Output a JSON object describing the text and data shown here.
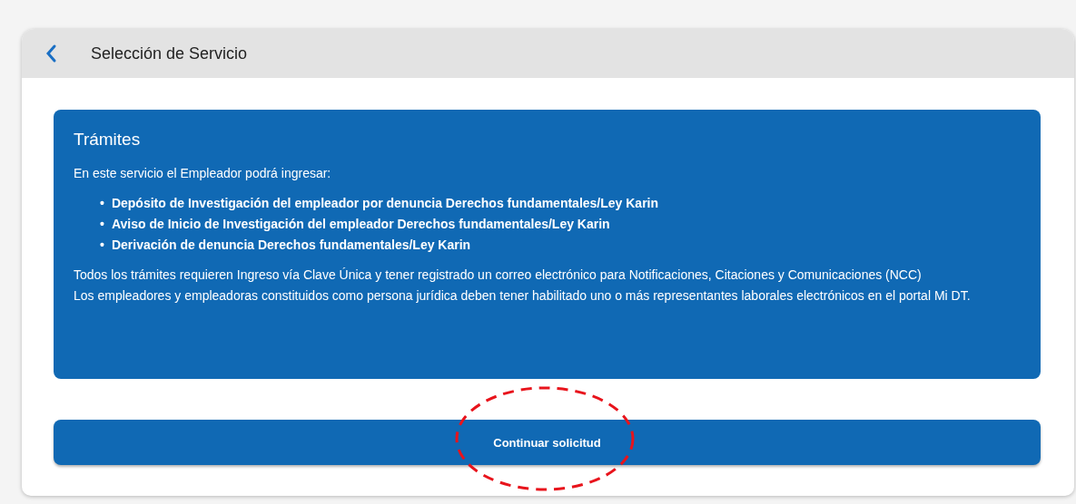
{
  "header": {
    "title": "Selección de Servicio"
  },
  "info_panel": {
    "title": "Trámites",
    "intro": "En este servicio el Empleador podrá ingresar:",
    "items": [
      {
        "bullet": "•",
        "text": "Depósito de Investigación del empleador por denuncia Derechos fundamentales/Ley Karin"
      },
      {
        "bullet": "•",
        "text": "Aviso de Inicio de Investigación del empleador Derechos fundamentales/Ley Karin"
      },
      {
        "bullet": "•",
        "text": "Derivación de denuncia Derechos fundamentales/Ley Karin"
      }
    ],
    "notes": [
      "Todos los trámites requieren Ingreso vía Clave Única y tener registrado un correo electrónico para Notificaciones, Citaciones y Comunicaciones (NCC)",
      "Los empleadores y empleadoras constituidos como persona jurídica deben tener habilitado uno o más representantes laborales electrónicos en el portal Mi DT."
    ]
  },
  "button": {
    "label": "Continuar solicitud"
  },
  "annotation": {
    "kind": "dashed-ellipse",
    "color": "#e8141c"
  }
}
